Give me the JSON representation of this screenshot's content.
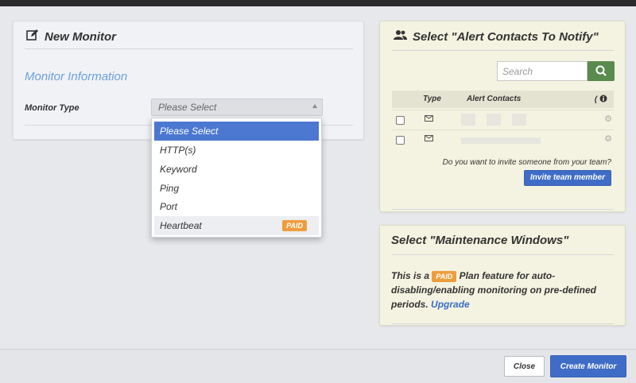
{
  "new_monitor": {
    "title": "New Monitor",
    "section_title": "Monitor Information",
    "monitor_type_label": "Monitor Type",
    "select_value": "Please Select",
    "options": [
      {
        "label": "Please Select",
        "selected": true
      },
      {
        "label": "HTTP(s)"
      },
      {
        "label": "Keyword"
      },
      {
        "label": "Ping"
      },
      {
        "label": "Port"
      },
      {
        "label": "Heartbeat",
        "badge": "PAID"
      }
    ]
  },
  "alert_contacts": {
    "title": "Select \"Alert Contacts To Notify\"",
    "search_placeholder": "Search",
    "columns": {
      "type": "Type",
      "contacts": "Alert Contacts",
      "info": "("
    },
    "invite_text": "Do you want to invite someone from your team?",
    "invite_button": "Invite team member"
  },
  "maintenance": {
    "title": "Select \"Maintenance Windows\"",
    "text_before": "This is a",
    "badge": "PAID",
    "text_after": "Plan feature for auto-disabling/enabling monitoring on pre-defined periods.",
    "link": "Upgrade"
  },
  "footer": {
    "close": "Close",
    "create": "Create Monitor"
  },
  "colors": {
    "primary": "#3f6cc6",
    "accent_link": "#6aa0dc",
    "paid_badge": "#ee9d3c",
    "search_button": "#5a8a4e"
  }
}
